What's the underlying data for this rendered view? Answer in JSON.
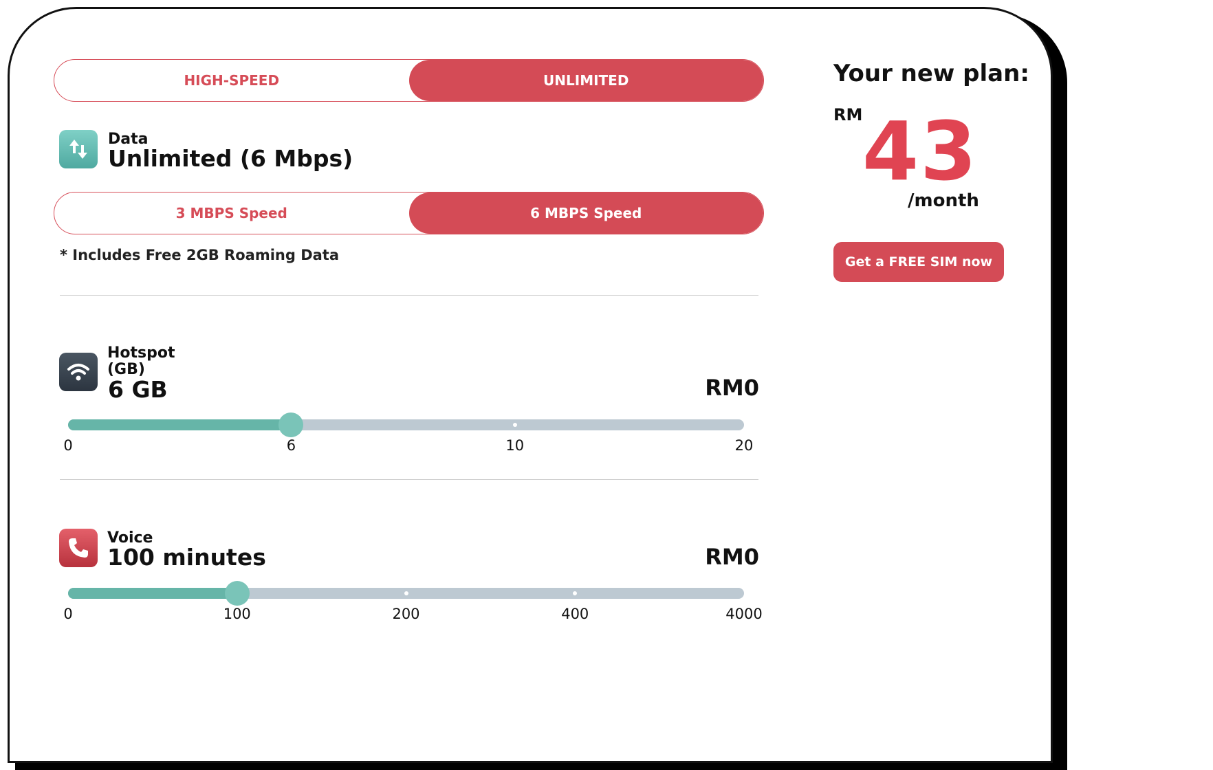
{
  "plan_type_toggle": {
    "options": [
      "HIGH-SPEED",
      "UNLIMITED"
    ],
    "selected": "UNLIMITED"
  },
  "data": {
    "label": "Data",
    "value": "Unlimited (6 Mbps)",
    "icon": "data-transfer-arrows-icon",
    "speed_options": [
      "3 MBPS Speed",
      "6 MBPS Speed"
    ],
    "selected_speed": "6 MBPS Speed",
    "note": "* Includes Free 2GB Roaming Data"
  },
  "hotspot": {
    "label_line1": "Hotspot",
    "label_line2": "(GB)",
    "value": "6 GB",
    "price": "RM0",
    "icon": "wifi-icon",
    "ticks": [
      "0",
      "6",
      "10",
      "20"
    ],
    "selected_index": 1
  },
  "voice": {
    "label": "Voice",
    "value": "100 minutes",
    "price": "RM0",
    "icon": "phone-icon",
    "ticks": [
      "0",
      "100",
      "200",
      "400",
      "4000"
    ],
    "selected_index": 1
  },
  "summary": {
    "title": "Your new plan:",
    "currency": "RM",
    "amount": "43",
    "period": "/month",
    "cta": "Get a FREE SIM now"
  },
  "colors": {
    "accent": "#d44b56",
    "teal": "#66b5a8",
    "track": "#bdc9d2",
    "price": "#e04452"
  }
}
